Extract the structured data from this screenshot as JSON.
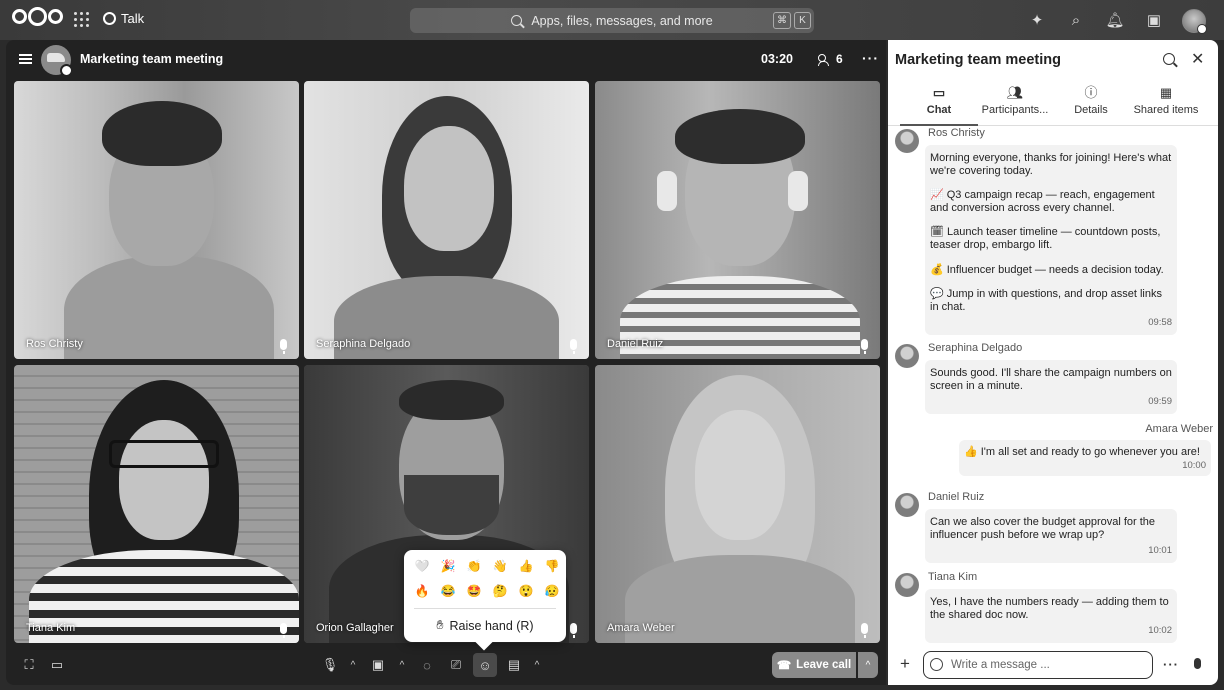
{
  "topbar": {
    "app_name": "Talk",
    "search_placeholder": "Apps, files, messages, and more",
    "shortcut_keys": [
      "⌘",
      "K"
    ]
  },
  "call": {
    "title": "Marketing team meeting",
    "timer": "03:20",
    "participant_count": "6",
    "tiles": [
      {
        "name": "Ros Christy"
      },
      {
        "name": "Seraphina Delgado"
      },
      {
        "name": "Daniel Ruiz"
      },
      {
        "name": "Tiana Kim"
      },
      {
        "name": "Orion Gallagher"
      },
      {
        "name": "Amara Weber"
      }
    ],
    "leave_label": "Leave call",
    "reactions": {
      "emojis_row1": [
        "🤍",
        "🎉",
        "👏",
        "👋",
        "👍",
        "👎"
      ],
      "emojis_row2": [
        "🔥",
        "😂",
        "🤩",
        "🤔",
        "😲",
        "😥"
      ],
      "raise_hand_label": "Raise hand (R)"
    }
  },
  "sidebar": {
    "title": "Marketing team meeting",
    "tabs": [
      {
        "label": "Chat",
        "icon": "chat-icon"
      },
      {
        "label": "Participants...",
        "icon": "participants-icon"
      },
      {
        "label": "Details",
        "icon": "info-icon"
      },
      {
        "label": "Shared items",
        "icon": "shared-items-icon"
      }
    ],
    "messages": [
      {
        "author": "Ros Christy",
        "paragraphs": [
          "Morning everyone, thanks for joining! Here's what we're covering today.",
          "📈 Q3 campaign recap — reach, engagement and conversion across every channel.",
          "🗓 Launch teaser timeline — countdown posts, teaser drop, embargo lift.",
          "💰 Influencer budget — needs a decision today.",
          "💬 Jump in with questions, and drop asset links in chat."
        ],
        "time": "09:58"
      },
      {
        "author": "Seraphina Delgado",
        "paragraphs": [
          "Sounds good. I'll share the campaign numbers on screen in a minute."
        ],
        "time": "09:59"
      },
      {
        "author": "Amara Weber",
        "paragraphs": [
          "👍 I'm all set and ready to go whenever you are!"
        ],
        "time": "10:00",
        "own": true
      },
      {
        "author": "Daniel Ruiz",
        "paragraphs": [
          "Can we also cover the budget approval for the influencer push before we wrap up?"
        ],
        "time": "10:01"
      },
      {
        "author": "Tiana Kim",
        "paragraphs": [
          "Yes, I have the numbers ready — adding them to the shared doc now."
        ],
        "time": "10:02"
      }
    ],
    "composer_placeholder": "Write a message ..."
  }
}
